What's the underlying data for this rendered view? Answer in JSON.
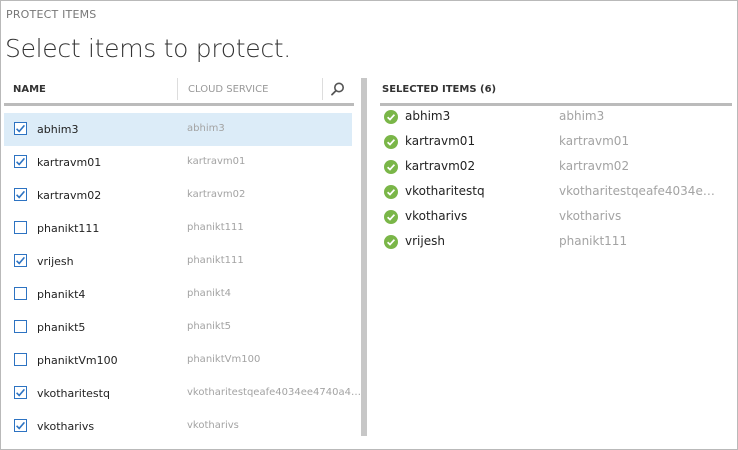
{
  "header": {
    "eyebrow": "PROTECT ITEMS",
    "title": "Select items to protect."
  },
  "left_table": {
    "columns": {
      "name": "NAME",
      "cloud_service": "CLOUD SERVICE"
    },
    "rows": [
      {
        "name": "abhim3",
        "service": "abhim3",
        "checked": true,
        "selected": true
      },
      {
        "name": "kartravm01",
        "service": "kartravm01",
        "checked": true,
        "selected": false
      },
      {
        "name": "kartravm02",
        "service": "kartravm02",
        "checked": true,
        "selected": false
      },
      {
        "name": "phanikt111",
        "service": "phanikt111",
        "checked": false,
        "selected": false
      },
      {
        "name": "vrijesh",
        "service": "phanikt111",
        "checked": true,
        "selected": false
      },
      {
        "name": "phanikt4",
        "service": "phanikt4",
        "checked": false,
        "selected": false
      },
      {
        "name": "phanikt5",
        "service": "phanikt5",
        "checked": false,
        "selected": false
      },
      {
        "name": "phaniktVm100",
        "service": "phaniktVm100",
        "checked": false,
        "selected": false
      },
      {
        "name": "vkotharitestq",
        "service": "vkotharitestqeafe4034ee4740a4…",
        "checked": true,
        "selected": false
      },
      {
        "name": "vkotharivs",
        "service": "vkotharivs",
        "checked": true,
        "selected": false
      }
    ]
  },
  "right_panel": {
    "title": "SELECTED ITEMS (6)",
    "items": [
      {
        "name": "abhim3",
        "service": "abhim3"
      },
      {
        "name": "kartravm01",
        "service": "kartravm01"
      },
      {
        "name": "kartravm02",
        "service": "kartravm02"
      },
      {
        "name": "vkotharitestq",
        "service": "vkotharitestqeafe4034e…"
      },
      {
        "name": "vkotharivs",
        "service": "vkotharivs"
      },
      {
        "name": "vrijesh",
        "service": "phanikt111"
      }
    ]
  },
  "colors": {
    "checkbox_border": "#2d73c2",
    "selected_row": "#dcecf8",
    "success_green": "#7ab648"
  },
  "icons": {
    "search": "search-icon",
    "check": "checkmark-icon",
    "success": "green-check-circle-icon"
  }
}
